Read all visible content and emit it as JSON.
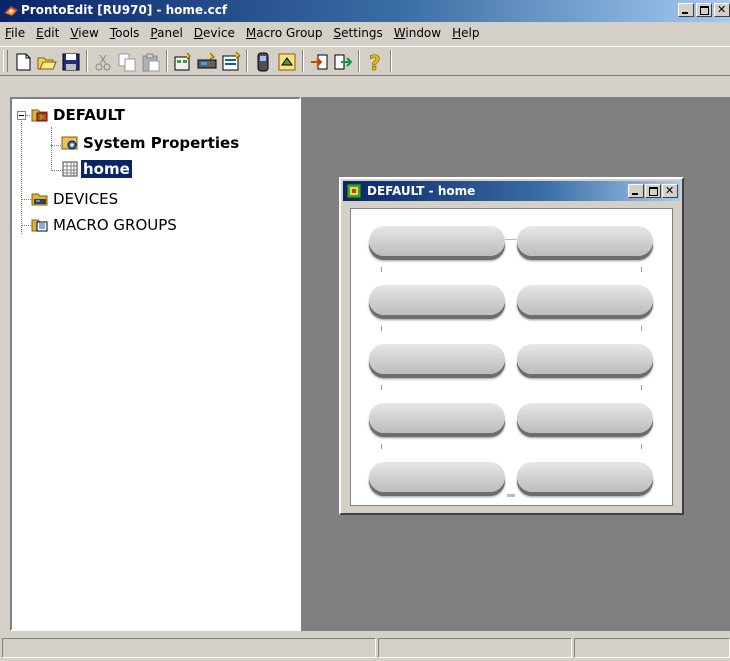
{
  "app": {
    "title": "ProntoEdit [RU970] - home.ccf",
    "icon": "pronto-app-icon"
  },
  "menu": [
    "File",
    "Edit",
    "View",
    "Tools",
    "Panel",
    "Device",
    "Macro Group",
    "Settings",
    "Window",
    "Help"
  ],
  "toolbar": [
    {
      "icon": "new-file-icon"
    },
    {
      "icon": "open-folder-icon"
    },
    {
      "icon": "save-icon"
    },
    {
      "icon": "cut-icon"
    },
    {
      "icon": "copy-icon"
    },
    {
      "icon": "paste-icon"
    },
    {
      "icon": "new-panel-icon"
    },
    {
      "icon": "new-device-icon"
    },
    {
      "icon": "new-macro-group-icon"
    },
    {
      "icon": "remote-icon"
    },
    {
      "icon": "properties-icon"
    },
    {
      "icon": "download-icon"
    },
    {
      "icon": "upload-icon"
    },
    {
      "icon": "help-icon"
    }
  ],
  "tree": {
    "root": "DEFAULT",
    "system_properties": "System Properties",
    "home": "home",
    "devices": "DEVICES",
    "macro_groups": "MACRO GROUPS"
  },
  "child_window": {
    "title": "DEFAULT - home",
    "button_count": 10
  }
}
